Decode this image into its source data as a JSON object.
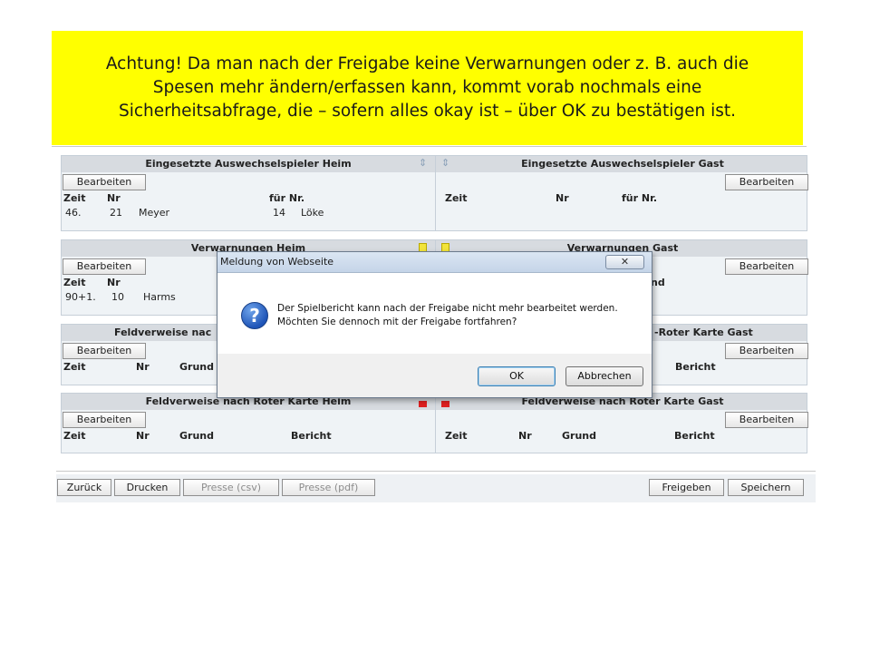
{
  "banner": {
    "line1": "Achtung! Da man nach der Freigabe keine Verwarnungen oder z. B. auch die",
    "line2": "Spesen mehr ändern/erfassen kann, kommt vorab nochmals eine",
    "line3": "Sicherheitsabfrage, die – sofern alles okay ist – über OK zu bestätigen ist."
  },
  "edit_label": "Bearbeiten",
  "sections": {
    "subs": {
      "home_title": "Eingesetzte Auswechselspieler Heim",
      "away_title": "Eingesetzte Auswechselspieler Gast",
      "columns": [
        "Zeit",
        "Nr",
        "für Nr."
      ],
      "home_row": {
        "zeit": "46.",
        "nr": "21",
        "name": "Meyer",
        "fuer_nr": "14",
        "fuer_name": "Löke"
      },
      "marker_icon": "substitution-arrow-icon"
    },
    "warnings": {
      "home_title": "Verwarnungen Heim",
      "away_title": "Verwarnungen Gast",
      "columns": [
        "Zeit",
        "Nr"
      ],
      "away_partial_col": "nd",
      "home_row": {
        "zeit": "90+1.",
        "nr": "10",
        "name": "Harms"
      },
      "marker_icon": "yellow-card-icon"
    },
    "yellowred": {
      "home_title": "Feldverweise nac",
      "away_title": "-Roter Karte Gast",
      "columns": [
        "Zeit",
        "Nr",
        "Grund"
      ],
      "away_partial_col": "Bericht"
    },
    "red": {
      "home_title": "Feldverweise nach Roter Karte Heim",
      "away_title": "Feldverweise nach Roter Karte Gast",
      "columns": [
        "Zeit",
        "Nr",
        "Grund",
        "Bericht"
      ],
      "marker_icon": "red-card-icon"
    }
  },
  "footer": {
    "back": "Zurück",
    "print": "Drucken",
    "press_csv": "Presse (csv)",
    "press_pdf": "Presse (pdf)",
    "release": "Freigeben",
    "save": "Speichern"
  },
  "dialog": {
    "title": "Meldung von Webseite",
    "close_glyph": "✕",
    "icon": "question-icon",
    "icon_glyph": "?",
    "message_line1": "Der Spielbericht kann nach der Freigabe nicht mehr bearbeitet werden.",
    "message_line2": "Möchten Sie dennoch mit der Freigabe fortfahren?",
    "ok": "OK",
    "cancel": "Abbrechen"
  },
  "colors": {
    "banner": "#ffff00",
    "section_bg": "#eff3f6",
    "header_bg": "#d7dbe0",
    "yellow_card": "#f2e43a",
    "red_card": "#e02020"
  }
}
